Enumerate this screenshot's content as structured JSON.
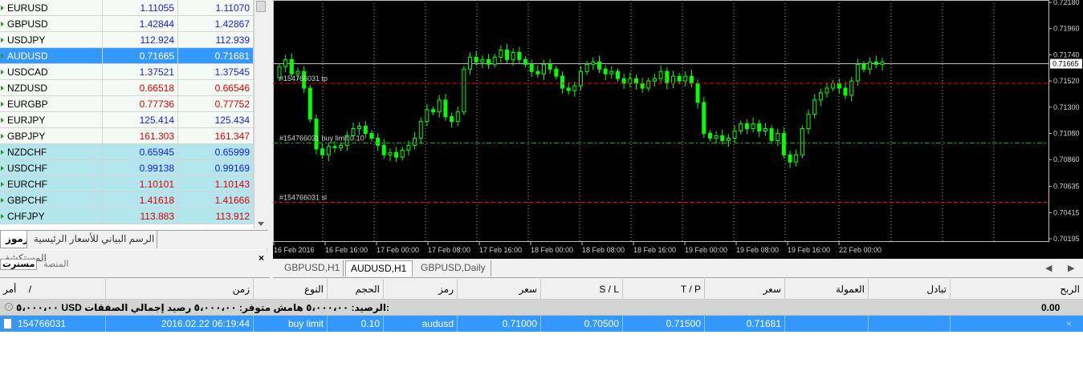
{
  "market_watch": {
    "rows": [
      {
        "symbol": "EURUSD",
        "bid": "1.11055",
        "ask": "1.11070",
        "bid_color": "blue",
        "ask_color": "blue",
        "bg": "g"
      },
      {
        "symbol": "GBPUSD",
        "bid": "1.42844",
        "ask": "1.42867",
        "bid_color": "blue",
        "ask_color": "blue",
        "bg": "g"
      },
      {
        "symbol": "USDJPY",
        "bid": "112.924",
        "ask": "112.939",
        "bid_color": "blue",
        "ask_color": "blue",
        "bg": "g"
      },
      {
        "symbol": "AUDUSD",
        "bid": "0.71665",
        "ask": "0.71681",
        "bid_color": "white",
        "ask_color": "white",
        "bg": "sel"
      },
      {
        "symbol": "USDCAD",
        "bid": "1.37521",
        "ask": "1.37545",
        "bid_color": "blue",
        "ask_color": "blue",
        "bg": "g"
      },
      {
        "symbol": "NZDUSD",
        "bid": "0.66518",
        "ask": "0.66546",
        "bid_color": "red",
        "ask_color": "red",
        "bg": "g"
      },
      {
        "symbol": "EURGBP",
        "bid": "0.77736",
        "ask": "0.77752",
        "bid_color": "red",
        "ask_color": "red",
        "bg": "g"
      },
      {
        "symbol": "EURJPY",
        "bid": "125.414",
        "ask": "125.434",
        "bid_color": "blue",
        "ask_color": "blue",
        "bg": "g"
      },
      {
        "symbol": "GBPJPY",
        "bid": "161.303",
        "ask": "161.347",
        "bid_color": "red",
        "ask_color": "red",
        "bg": "g"
      },
      {
        "symbol": "NZDCHF",
        "bid": "0.65945",
        "ask": "0.65999",
        "bid_color": "blue",
        "ask_color": "blue",
        "bg": "c"
      },
      {
        "symbol": "USDCHF",
        "bid": "0.99138",
        "ask": "0.99169",
        "bid_color": "blue",
        "ask_color": "blue",
        "bg": "c"
      },
      {
        "symbol": "EURCHF",
        "bid": "1.10101",
        "ask": "1.10143",
        "bid_color": "red",
        "ask_color": "red",
        "bg": "c"
      },
      {
        "symbol": "GBPCHF",
        "bid": "1.41618",
        "ask": "1.41666",
        "bid_color": "red",
        "ask_color": "red",
        "bg": "c"
      },
      {
        "symbol": "CHFJPY",
        "bid": "113.883",
        "ask": "113.912",
        "bid_color": "red",
        "ask_color": "red",
        "bg": "c"
      }
    ],
    "tabs": {
      "symbols": "رموز",
      "tick_chart": "الرسم البياني للأسعار الرئيسية"
    }
  },
  "navigator": {
    "title": "المستكشف",
    "tab1": "مسترت",
    "tab2": "المنصة",
    "close": "×"
  },
  "chart": {
    "price_labels": [
      "0.72180",
      "0.71960",
      "0.71740",
      "0.71520",
      "0.71300",
      "0.71080",
      "0.70860",
      "0.70635",
      "0.70415",
      "0.70195"
    ],
    "current_price": "0.71665",
    "time_labels": [
      "16 Feb 2016",
      "16 Feb 16:00",
      "17 Feb 00:00",
      "17 Feb 08:00",
      "17 Feb 16:00",
      "18 Feb 00:00",
      "18 Feb 08:00",
      "18 Feb 16:00",
      "19 Feb 00:00",
      "19 Feb 08:00",
      "19 Feb 16:00",
      "22 Feb 00:00"
    ],
    "order_lines": {
      "tp_label": "#154766031 tp",
      "entry_label": "#154766031 buy limit 0.10",
      "sl_label": "#154766031 sl",
      "tp_price": 0.715,
      "entry_price": 0.71,
      "sl_price": 0.705
    },
    "colors": {
      "background": "#000000",
      "candle": "#00ff00",
      "tp_sl_line": "#ff0000",
      "entry_line": "#00c000",
      "grid": "#c0c0c0",
      "current_price_line": "#c0c0c0"
    }
  },
  "chart_tabs": [
    "GBPUSD,H1",
    "AUDUSD,H1",
    "GBPUSD,Daily"
  ],
  "chart_tabs_active": 1,
  "chart_tabs_nav": {
    "prev": "◀",
    "next": "▶"
  },
  "terminal": {
    "headers": {
      "order": "أمر",
      "sort": "/",
      "time": "زمن",
      "type": "النوع",
      "volume": "الحجم",
      "symbol": "رمز",
      "price": "سعر",
      "sl": "S / L",
      "tp": "T / P",
      "price2": "سعر",
      "commission": "العمولة",
      "swap": "تبادل",
      "profit": "الربح"
    },
    "summary": "٥،٠٠٠،٠٠ USD  الرصيد: ٥،٠٠٠،٠٠  هامش متوفر: ٥،٠٠٠،٠٠  رصيد إجمالي الصفقات:",
    "summary_profit": "0.00",
    "order_row": {
      "order": "154766031",
      "time": "2016.02.22 06:19:44",
      "type": "buy limit",
      "volume": "0.10",
      "symbol": "audusd",
      "price": "0.71000",
      "sl": "0.70500",
      "tp": "0.71500",
      "price2": "0.71681",
      "close": "×"
    }
  }
}
